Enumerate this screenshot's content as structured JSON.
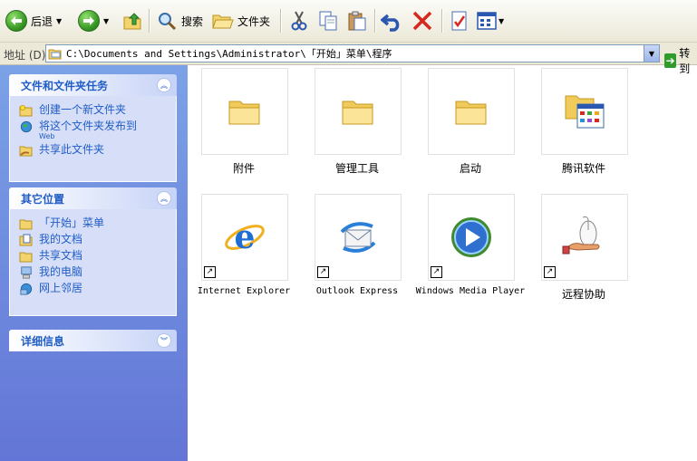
{
  "toolbar": {
    "back_label": "后退",
    "search_label": "搜索",
    "folders_label": "文件夹"
  },
  "addressbar": {
    "label": "地址 (D)",
    "path": "C:\\Documents and Settings\\Administrator\\「开始」菜单\\程序",
    "go_label": "转到"
  },
  "leftpane": {
    "file_tasks": {
      "title": "文件和文件夹任务",
      "items": [
        {
          "label": "创建一个新文件夹",
          "sub": ""
        },
        {
          "label": "将这个文件夹发布到",
          "sub": "Web"
        },
        {
          "label": "共享此文件夹",
          "sub": ""
        }
      ]
    },
    "other_places": {
      "title": "其它位置",
      "items": [
        {
          "label": "「开始」菜单"
        },
        {
          "label": "我的文档"
        },
        {
          "label": "共享文档"
        },
        {
          "label": "我的电脑"
        },
        {
          "label": "网上邻居"
        }
      ]
    },
    "details": {
      "title": "详细信息"
    }
  },
  "items": [
    {
      "label": "附件",
      "icon": "folder-icon"
    },
    {
      "label": "管理工具",
      "icon": "folder-icon"
    },
    {
      "label": "启动",
      "icon": "folder-icon"
    },
    {
      "label": "腾讯软件",
      "icon": "program-folder-icon"
    },
    {
      "label": "Internet Explorer",
      "icon": "internet-explorer-icon"
    },
    {
      "label": "Outlook Express",
      "icon": "outlook-express-icon"
    },
    {
      "label": "Windows Media Player",
      "icon": "media-player-icon"
    },
    {
      "label": "远程协助",
      "icon": "remote-assistance-icon"
    }
  ]
}
